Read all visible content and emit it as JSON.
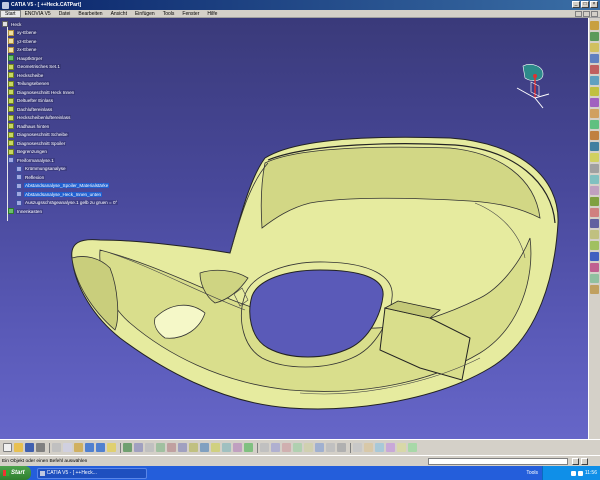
{
  "window": {
    "title": "CATIA V5 - [ ++Heck.CATPart]",
    "controls": [
      "_",
      "□",
      "×"
    ]
  },
  "menu": {
    "items": [
      "Start",
      "ENOVIA V5",
      "Datei",
      "Bearbeiten",
      "Ansicht",
      "Einfügen",
      "Tools",
      "Fenster",
      "Hilfe"
    ]
  },
  "tree": {
    "nodes": [
      {
        "label": "Heck",
        "icon": "part-icon",
        "level": 0
      },
      {
        "label": "xy-Ebene",
        "icon": "plane-icon",
        "level": 1
      },
      {
        "label": "yz-Ebene",
        "icon": "plane-icon",
        "level": 1
      },
      {
        "label": "zx-Ebene",
        "icon": "plane-icon",
        "level": 1
      },
      {
        "label": "Hauptkörper",
        "icon": "body-icon",
        "level": 1
      },
      {
        "label": "Geometrisches Set.1",
        "icon": "geometric-set-icon",
        "level": 1
      },
      {
        "label": "Heckscheibe",
        "icon": "geometric-set-icon",
        "level": 1
      },
      {
        "label": "Teilungsebenen",
        "icon": "geometric-set-icon",
        "level": 1
      },
      {
        "label": "Diagnoseschnitt Heck Innen",
        "icon": "geometric-set-icon",
        "level": 1
      },
      {
        "label": "Deltuefter Einlass",
        "icon": "geometric-set-icon",
        "level": 1
      },
      {
        "label": "Dachluftereinlass",
        "icon": "geometric-set-icon",
        "level": 1
      },
      {
        "label": "Heckscheibenluftereinlass",
        "icon": "geometric-set-icon",
        "level": 1
      },
      {
        "label": "Radhaus hinten",
        "icon": "geometric-set-icon",
        "level": 1
      },
      {
        "label": "Diagnoseschnitt Scheibe",
        "icon": "geometric-set-icon",
        "level": 1
      },
      {
        "label": "Diagnoseschnitt Spoiler",
        "icon": "geometric-set-icon",
        "level": 1
      },
      {
        "label": "Begrenzungen",
        "icon": "geometric-set-icon",
        "level": 1
      },
      {
        "label": "Freiformanalyse.1",
        "icon": "analysis-icon",
        "level": 1
      },
      {
        "label": "Krümmungsanalyse",
        "icon": "analysis-icon",
        "level": 2
      },
      {
        "label": "Reflexion",
        "icon": "analysis-icon",
        "level": 2
      },
      {
        "label": "Abstandsanalyse_Spoiler_Materialstärke",
        "icon": "analysis-icon",
        "level": 2
      },
      {
        "label": "Abstandsanalyse_Heck_Innen_unten",
        "icon": "analysis-icon",
        "level": 2
      },
      {
        "label": "Auszugsschrägeanalyse.1 gelb zu gruen = 0°",
        "icon": "analysis-icon",
        "level": 2
      },
      {
        "label": "Innenkasten",
        "icon": "body-icon",
        "level": 1
      }
    ]
  },
  "viewport": {
    "background_top": "#3a3a7a",
    "background_bottom": "#6666c8",
    "part_color": "#e6eb9f",
    "part_shade": "#c9ce7c"
  },
  "status": {
    "message": "Ein Objekt oder einen Befehl auswählen"
  },
  "taskbar": {
    "start": "Start",
    "task": "CATIA V5 - [ ++Heck...",
    "tools": "Tools",
    "time": "11:56"
  },
  "colors": {
    "titlebar": "#0a246a",
    "taskbar": "#245edb",
    "start": "#3c9a3c",
    "tray": "#0f8fe8"
  }
}
